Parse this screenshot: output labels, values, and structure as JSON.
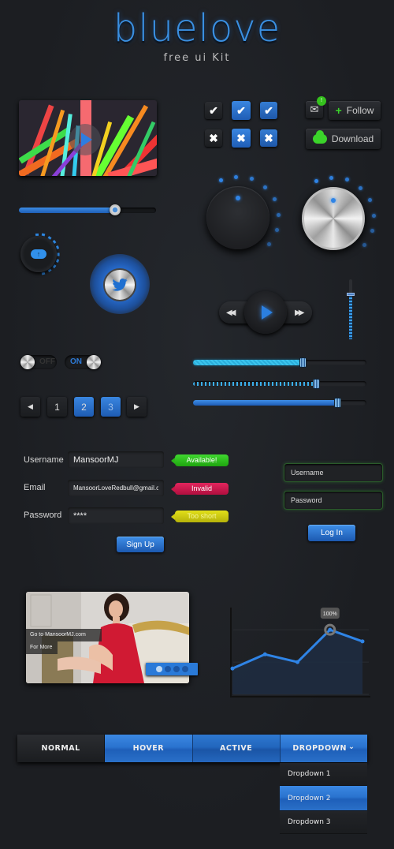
{
  "header": {
    "title": "bluelove",
    "subtitle": "free ui Kit"
  },
  "video_player": {
    "progress_percent": 70
  },
  "checkboxes": {
    "row1": [
      "check",
      "check",
      "check"
    ],
    "row2": [
      "cross",
      "cross",
      "cross"
    ],
    "check_glyph": "✔",
    "cross_glyph": "✖"
  },
  "social": {
    "mail_icon": "✉",
    "notification_badge": "!",
    "follow_label": "Follow",
    "follow_icon": "+",
    "download_label": "Download"
  },
  "knobs": {
    "dark_knob_level": 0.5,
    "silver_knob_level": 0.5
  },
  "upload": {
    "icon": "↑"
  },
  "twitter": {
    "icon": "🐦"
  },
  "media": {
    "rewind_icon": "◀◀",
    "forward_icon": "▶▶"
  },
  "volume": {
    "level_percent": 75
  },
  "toggles": {
    "off_label": "OFF",
    "on_label": "ON"
  },
  "pagination": {
    "prev_icon": "◀",
    "next_icon": "▶",
    "pages": [
      "1",
      "2",
      "3"
    ],
    "current_page": "2"
  },
  "sliders": [
    {
      "style": "cyan",
      "value_percent": 63
    },
    {
      "style": "dashed",
      "value_percent": 71
    },
    {
      "style": "blue",
      "value_percent": 83
    }
  ],
  "signup_form": {
    "username_label": "Username",
    "username_value": "MansoorMJ",
    "username_status": "Available!",
    "email_label": "Email",
    "email_value": "MansoorLoveRedbull@gmail.com",
    "email_status": "Invalid",
    "password_label": "Password",
    "password_value": "****",
    "password_status": "Too short",
    "submit_label": "Sign Up"
  },
  "login_form": {
    "username_placeholder": "Username",
    "password_placeholder": "Password",
    "submit_label": "Log In"
  },
  "photo_slider": {
    "caption_line1": "Go to MansoorMJ.com",
    "caption_line2": "For More",
    "slide_count": 4,
    "active_slide": 1
  },
  "chart_data": {
    "type": "area",
    "title": "",
    "x": [
      1,
      2,
      3,
      4,
      5
    ],
    "values": [
      40,
      62,
      50,
      100,
      82
    ],
    "ylim": [
      0,
      110
    ],
    "tooltip": "100%",
    "highlight_index": 3,
    "grid": true
  },
  "nav": {
    "items": [
      {
        "label": "NORMAL",
        "state": "normal"
      },
      {
        "label": "HOVER",
        "state": "hover"
      },
      {
        "label": "ACTIVE",
        "state": "active"
      },
      {
        "label": "DROPDOWN",
        "state": "dropdown"
      }
    ],
    "dropdown_caret": "⌄",
    "dropdown_items": [
      "Dropdown 1",
      "Dropdown 2",
      "Dropdown 3"
    ],
    "dropdown_selected": "Dropdown 2"
  },
  "colors": {
    "accent_blue": "#2f84e6",
    "success_green": "#35c21d",
    "error_red": "#d11c50",
    "warning_yellow": "#d9d516",
    "background": "#1e2024"
  }
}
